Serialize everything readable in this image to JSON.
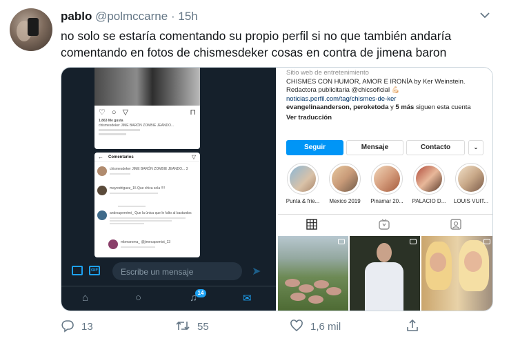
{
  "tweet": {
    "name": "pablo",
    "handle": "@polmccarne",
    "separator": "·",
    "time": "15h",
    "text_line1": "no solo se estaría comentando su propio perfil si no que también andaría",
    "text_line2": "comentando en fotos de chismesdeker cosas en contra de jimena baron"
  },
  "dm_screenshot": {
    "post_likes": "1.863 Me gusta",
    "post_caption": "chismesdeker JIME BARÓN ZOMBIE JEANDO...",
    "comments_title": "Comentarios",
    "comments": [
      {
        "user": "chismesdeker JIME BARÓN ZOMBIE JEANDO... 3"
      },
      {
        "user": "mayrodriguez_15 Que chica sola !!!!"
      },
      {
        "user": "andrsuperntmi_ Que la única que le falto al bastardos"
      },
      {
        "user": "mbmaroma_ @jimecapomist_13"
      }
    ],
    "gif_label": "GIF",
    "message_placeholder": "Escribe un mensaje",
    "notif_count": "14"
  },
  "instagram": {
    "category": "Sitio web de entretenimiento",
    "bio": "CHISMES CON HUMOR, AMOR E IRONÍA by Ker Weinstein. Redactora publicitaria @chicsoficial 💪🏻",
    "link": "noticias.perfil.com/tag/chismes-de-ker",
    "followed_by_names": "evangelinaanderson, peroketoda",
    "followed_by_mid": " y ",
    "followed_by_more": "5 más",
    "followed_by_end": " siguen esta cuenta",
    "translate": "Ver traducción",
    "buttons": {
      "follow": "Seguir",
      "message": "Mensaje",
      "contact": "Contacto"
    },
    "highlights": [
      {
        "label": "Punta & frie..."
      },
      {
        "label": "Mexico 2019"
      },
      {
        "label": "Pinamar 20..."
      },
      {
        "label": "PALACIO D..."
      },
      {
        "label": "LOUIS VUIT..."
      }
    ]
  },
  "actions": {
    "replies": "13",
    "retweets": "55",
    "likes": "1,6 mil"
  },
  "colors": {
    "twitter_blue": "#1da1f2",
    "dark_bg": "#15202b",
    "ig_follow": "#0095f6"
  }
}
